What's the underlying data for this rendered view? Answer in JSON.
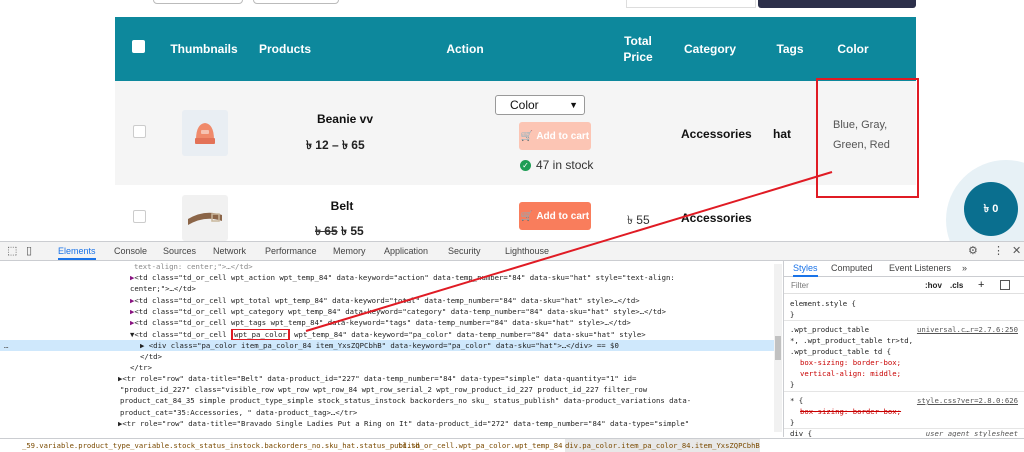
{
  "table": {
    "headers": [
      "Thumbnails",
      "Products",
      "Action",
      "Total Price",
      "Category",
      "Tags",
      "Color"
    ],
    "rows": [
      {
        "product": "Beanie vv",
        "price": "৳ 12 – ৳ 65",
        "select_value": "Color",
        "cart_label": "Add to cart",
        "stock": "47 in stock",
        "category": "Accessories",
        "tags": "hat",
        "color_line1": "Blue, Gray,",
        "color_line2": "Green, Red"
      },
      {
        "product": "Belt",
        "price_old": "৳ 65",
        "price_new": "৳ 55",
        "cart_label": "Add to cart",
        "total": "৳ 55",
        "category": "Accessories"
      }
    ]
  },
  "cart_fab": {
    "label": "৳ 0"
  },
  "devtools": {
    "tabs": [
      "Elements",
      "Console",
      "Sources",
      "Network",
      "Performance",
      "Memory",
      "Application",
      "Security",
      "Lighthouse"
    ],
    "dom_lines": {
      "l0": "text-align: center;\">…</td>",
      "l1": "<td class=\"td_or_cell wpt_action wpt_temp_84\" data-keyword=\"action\" data-temp_number=\"84\" data-sku=\"hat\" style=\"text-align:",
      "l2": "center;\">…</td>",
      "l3": "<td class=\"td_or_cell wpt_total wpt_temp_84\" data-keyword=\"total\" data-temp_number=\"84\" data-sku=\"hat\" style>…</td>",
      "l4": "<td class=\"td_or_cell wpt_category wpt_temp_84\" data-keyword=\"category\" data-temp_number=\"84\" data-sku=\"hat\" style>…</td>",
      "l5": "<td class=\"td_or_cell wpt_tags wpt_temp_84\" data-keyword=\"tags\" data-temp_number=\"84\" data-sku=\"hat\" style>…</td>",
      "l6_pre": "▼<td class=\"td_or_cell ",
      "l6_box": "wpt_pa_color",
      "l6_post": " wpt_temp_84\" data-keyword=\"pa_color\" data-temp_number=\"84\" data-sku=\"hat\" style>",
      "l7": "▶ <div class=\"pa_color item_pa_color_84 item_YxsZQPCbhB\" data-keyword=\"pa_color\" data-sku=\"hat\">…</div> == $0",
      "l8": "</td>",
      "l9": "</tr>",
      "l10": "▶<tr role=\"row\" data-title=\"Belt\" data-product_id=\"227\" data-temp_number=\"84\" data-type=\"simple\" data-quantity=\"1\" id=",
      "l11": "\"product_id_227\" class=\"visible_row wpt_row wpt_row_84 wpt_row_serial_2 wpt_row_product_id_227 product_id_227 filter_row",
      "l12": "product_cat_84_35  simple product_type_simple stock_status_instock backorders_no sku_ status_publish\" data-product_variations data-",
      "l13": "product_cat=\"35:Accessories, \" data-product_tag>…</tr>",
      "l14": "▶<tr role=\"row\" data-title=\"Bravado Single Ladies Put a Ring on It\" data-product_id=\"272\" data-temp_number=\"84\" data-type=\"simple\""
    },
    "ellipsis": "…",
    "styles": {
      "tabs": [
        "Styles",
        "Computed",
        "Event Listeners",
        "»"
      ],
      "filter_placeholder": "Filter",
      "hov": ":hov",
      "cls": ".cls",
      "plus": "+",
      "element_style": "element.style {",
      "close": "}",
      "rule1_selector": ".wpt_product_table",
      "rule1_link": "universal.c…r=2.7.6:250",
      "rule1_sel2": "*, .wpt_product_table tr>td,",
      "rule1_sel3": ".wpt_product_table td {",
      "rule1_p1": "box-sizing: border-box;",
      "rule1_p2": "vertical-align: middle;",
      "rule2_selector": "* {",
      "rule2_link": "style.css?ver=2.8.0:626",
      "rule2_p1": "box-sizing: border-box;",
      "rule3_selector": "div {",
      "rule3_link": "user agent stylesheet"
    },
    "breadcrumbs": [
      "_59.variable.product_type_variable.stock_status_instock.backorders_no.sku_hat.status_publish",
      "td.td_or_cell.wpt_pa_color.wpt_temp_84",
      "div.pa_color.item_pa_color_84.item_YxsZQPCbhB"
    ]
  },
  "colors": {
    "table_header": "#0d889c",
    "add_to_cart": "#f97d5c",
    "add_to_cart_disabled": "#fcc5b4",
    "annotation": "#e01b24",
    "devtools_accent": "#1a73e8"
  }
}
